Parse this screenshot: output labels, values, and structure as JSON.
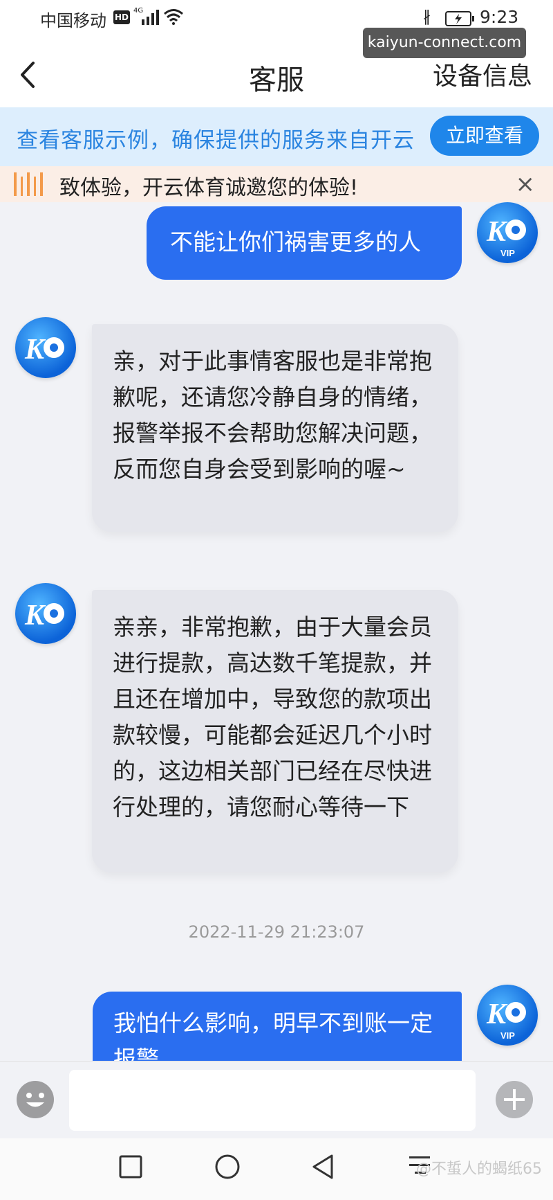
{
  "status_bar": {
    "carrier": "中国移动",
    "hd": "HD",
    "network": "4G",
    "time": "9:23"
  },
  "watermark_url": "kaiyun-connect.com",
  "header": {
    "title": "客服",
    "right_label": "设备信息"
  },
  "notice": {
    "text": "查看客服示例，确保提供的服务来自开云",
    "button_label": "立即查看"
  },
  "marquee": {
    "text": "致体验，开云体育诚邀您的体验!",
    "close_icon": "×"
  },
  "chat": {
    "messages": [
      {
        "from": "user",
        "text": "不能让你们祸害更多的人"
      },
      {
        "from": "agent",
        "text": "亲，对于此事情客服也是非常抱歉呢，还请您冷静自身的情绪，报警举报不会帮助您解决问题，反而您自身会受到影响的喔~"
      },
      {
        "from": "agent",
        "text": "亲亲，非常抱歉，由于大量会员进行提款，高达数千笔提款，并且还在增加中，导致您的款项出款较慢，可能都会延迟几个小时的，这边相关部门已经在尽快进行处理的，请您耐心等待一下"
      },
      {
        "from": "user",
        "text": "我怕什么影响，明早不到账一定报警"
      }
    ],
    "timestamp": "2022-11-29 21:23:07",
    "avatar_label": "VIP"
  },
  "input": {
    "placeholder": ""
  },
  "bottom_watermark": "@不蜇人的蝎纸65",
  "icons": [
    "back-arrow-icon",
    "emoji-icon",
    "plus-icon",
    "square-nav-icon",
    "circle-nav-icon",
    "triangle-back-nav-icon",
    "menu-nav-icon"
  ],
  "colors": {
    "accent": "#1f86ea",
    "user_bubble": "#2a6ef0",
    "agent_bubble": "#e5e6ec",
    "notice_bg": "#ddeefd",
    "marquee_bg": "#fbeee6"
  }
}
